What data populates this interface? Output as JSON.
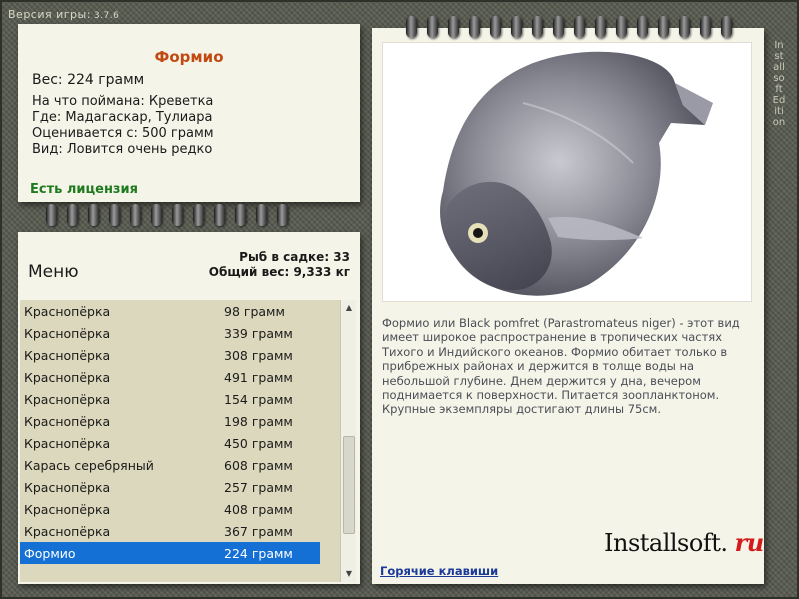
{
  "header": {
    "version_label": "Версия игры:",
    "version_number": "3.7.6"
  },
  "info": {
    "title": "Формио",
    "weight": "Вес: 224 грамм",
    "caught_on": "На что поймана: Креветка",
    "where": "Где: Мадагаскар, Тулиара",
    "valued_from": "Оценивается с: 500 грамм",
    "type": "Вид: Ловится очень редко",
    "license": "Есть лицензия"
  },
  "menu": {
    "label": "Меню",
    "fish_in_cage": "Рыб в садке: 33",
    "total_weight": "Общий вес: 9,333 кг",
    "rows": [
      {
        "name": "Краснопёрка",
        "weight": "98 грамм"
      },
      {
        "name": "Краснопёрка",
        "weight": "339 грамм"
      },
      {
        "name": "Краснопёрка",
        "weight": "308 грамм"
      },
      {
        "name": "Краснопёрка",
        "weight": "491 грамм"
      },
      {
        "name": "Краснопёрка",
        "weight": "154 грамм"
      },
      {
        "name": "Краснопёрка",
        "weight": "198 грамм"
      },
      {
        "name": "Краснопёрка",
        "weight": "450 грамм"
      },
      {
        "name": "Карась серебряный",
        "weight": "608 грамм"
      },
      {
        "name": "Краснопёрка",
        "weight": "257 грамм"
      },
      {
        "name": "Краснопёрка",
        "weight": "408 грамм"
      },
      {
        "name": "Краснопёрка",
        "weight": "367 грамм"
      },
      {
        "name": "Формио",
        "weight": "224 грамм",
        "selected": true
      }
    ],
    "scroll_position_fraction": 0.78
  },
  "detail": {
    "description": "Формио или Black pomfret (Parastromateus niger) - этот вид имеет широкое распространение в тропических частях Тихого и Индийского океанов. Формио обитает только в прибрежных районах и держится в толще воды на небольшой глубине. Днем держится у дна, вечером поднимается к поверхности. Питается зоопланктоном. Крупные экземпляры достигают длины 75см.",
    "hotkeys_link": "Горячие клавиши",
    "brand_main": "Installsoft.",
    "brand_suffix": "ru"
  },
  "side_text": "Installsoft Edition",
  "colors": {
    "title": "#c24a12",
    "license": "#1e7a1e",
    "selection": "#1470d4",
    "link": "#1a3a9a",
    "brand_accent": "#d41a1a"
  }
}
